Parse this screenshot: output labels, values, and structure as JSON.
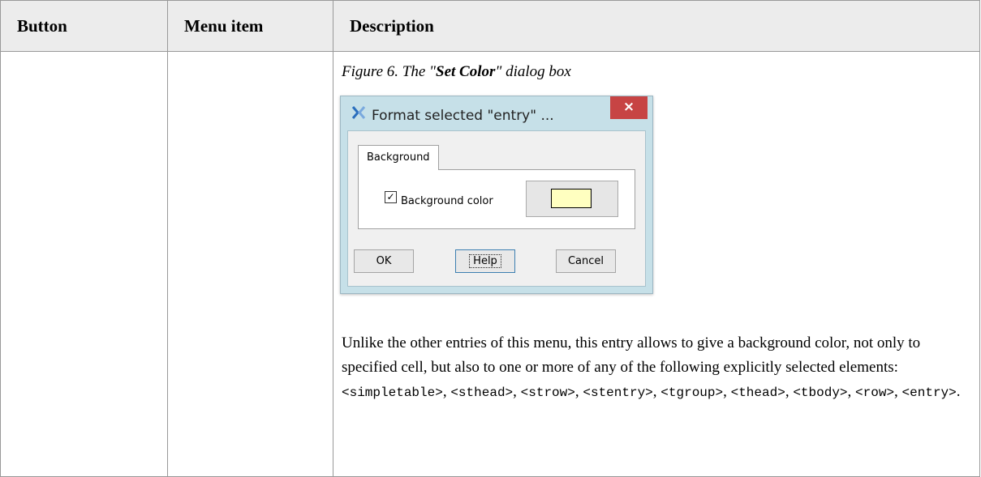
{
  "headers": {
    "button": "Button",
    "menu_item": "Menu item",
    "description": "Description"
  },
  "caption": {
    "prefix": "Figure 6. The \"",
    "bold": "Set Color",
    "suffix": "\" dialog box"
  },
  "dialog": {
    "title": "Format selected \"entry\" ...",
    "close_glyph": "×",
    "icon": "xmlmind-icon",
    "tab_label": "Background",
    "checkbox_checked": true,
    "checkbox_glyph": "✓",
    "checkbox_label": "Background color",
    "swatch_color": "#ffffc0",
    "buttons": {
      "ok": "OK",
      "help": "Help",
      "cancel": "Cancel"
    }
  },
  "paragraph": {
    "text": "Unlike the other entries of this menu, this entry allows to give a background color, not only to specified cell, but also to one or more of any of the following explicitly selected elements: ",
    "elements": [
      "<simpletable>",
      "<sthead>",
      "<strow>",
      "<stentry>",
      "<tgroup>",
      "<thead>",
      "<tbody>",
      "<row>",
      "<entry>"
    ],
    "separator": ", ",
    "end": "."
  }
}
